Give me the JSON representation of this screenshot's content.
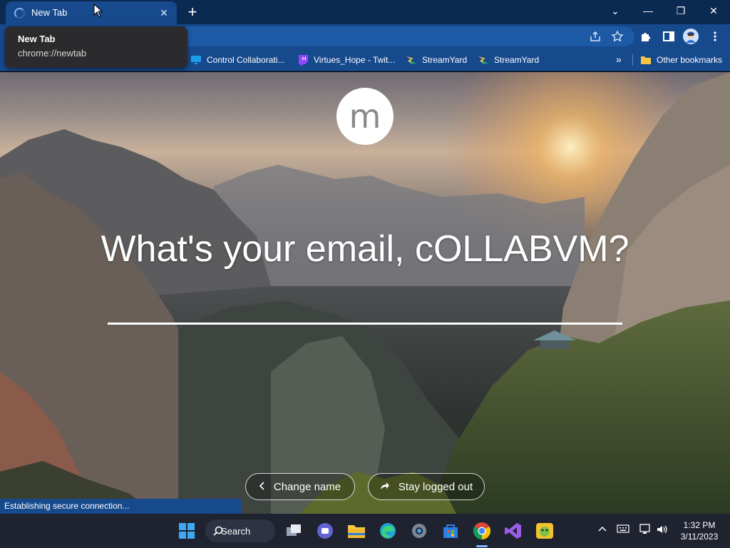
{
  "browser": {
    "tab": {
      "title": "New Tab",
      "close": "×"
    },
    "new_tab_symbol": "+",
    "window_controls": {
      "dropdown": "⌄",
      "minimize": "—",
      "restore": "❐",
      "close": "✕"
    },
    "tooltip": {
      "title": "New Tab",
      "url": "chrome://newtab"
    },
    "bookmarks": [
      {
        "label": "Control Collaborati...",
        "icon": "monitor-icon"
      },
      {
        "label": "Virtues_Hope - Twit...",
        "icon": "twitch-icon"
      },
      {
        "label": "StreamYard",
        "icon": "streamyard-icon"
      },
      {
        "label": "StreamYard",
        "icon": "streamyard-icon"
      }
    ],
    "bookmarks_more": "»",
    "other_bookmarks": "Other bookmarks",
    "status": "Establishing secure connection..."
  },
  "newtab": {
    "avatar_letter": "m",
    "question": "What's your email, cOLLABVM?",
    "email_value": "",
    "buttons": {
      "change_name": "Change name",
      "stay_logged_out": "Stay logged out"
    }
  },
  "taskbar": {
    "search_label": "Search",
    "clock_time": "1:32 PM",
    "clock_date": "3/11/2023"
  },
  "colors": {
    "tab_strip": "#0b2a52",
    "toolbar": "#17498d",
    "taskbar": "#1f2330"
  }
}
